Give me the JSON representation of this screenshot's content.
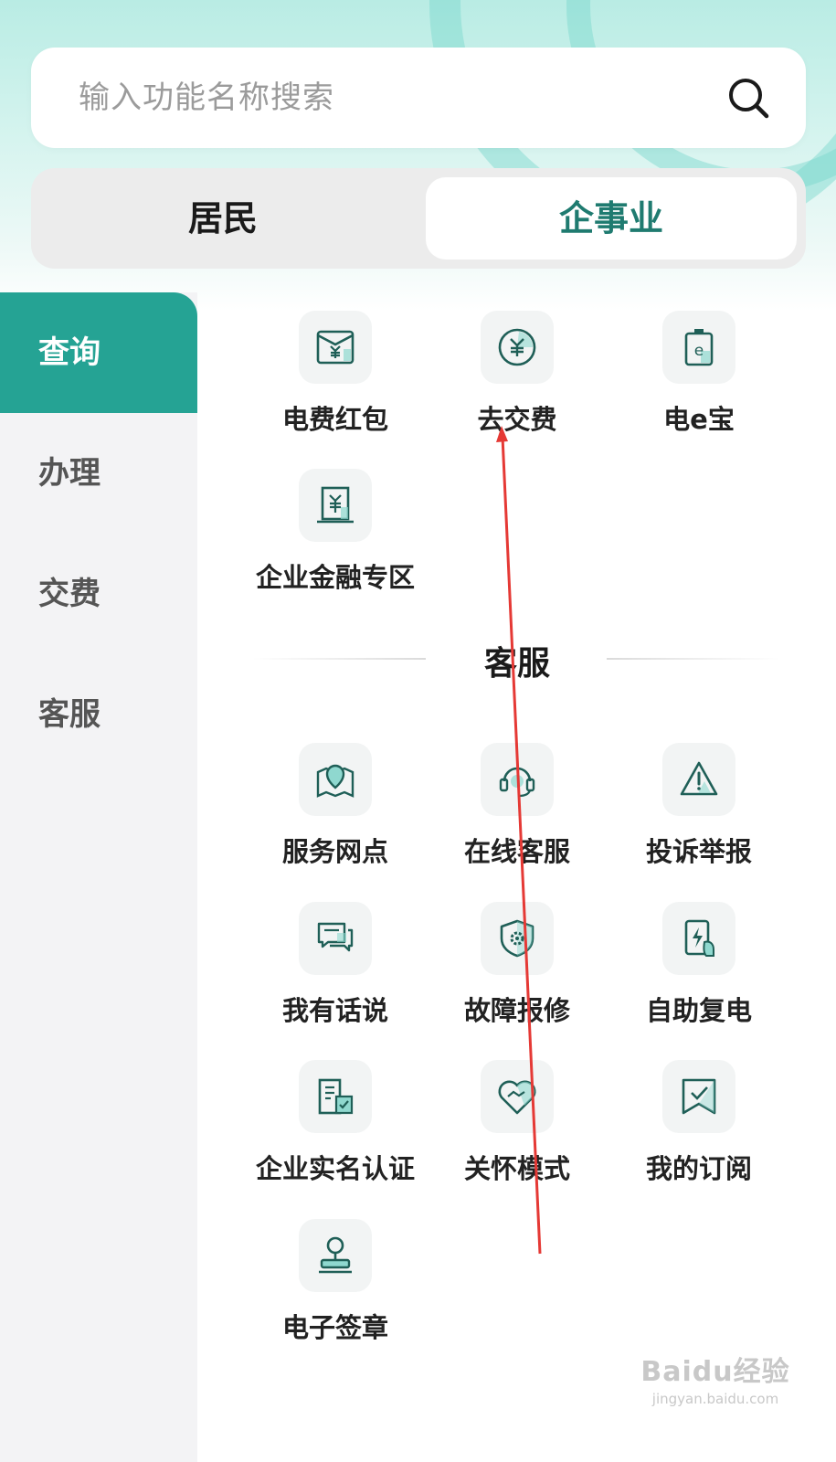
{
  "search": {
    "placeholder": "输入功能名称搜索",
    "icon": "search-icon"
  },
  "segment": {
    "tabs": [
      {
        "label": "居民",
        "active": false
      },
      {
        "label": "企事业",
        "active": true
      }
    ]
  },
  "sidebar": {
    "items": [
      {
        "label": "查询",
        "active": true
      },
      {
        "label": "办理",
        "active": false
      },
      {
        "label": "交费",
        "active": false
      },
      {
        "label": "客服",
        "active": false
      }
    ]
  },
  "query_items": [
    {
      "label": "电费红包",
      "icon": "bill-envelope-icon"
    },
    {
      "label": "去交费",
      "icon": "yuan-coin-icon"
    },
    {
      "label": "电e宝",
      "icon": "battery-e-icon"
    },
    {
      "label": "企业金融专区",
      "icon": "finance-building-icon"
    }
  ],
  "service_section": {
    "title": "客服"
  },
  "service_items": [
    {
      "label": "服务网点",
      "icon": "map-pin-icon"
    },
    {
      "label": "在线客服",
      "icon": "headset-icon"
    },
    {
      "label": "投诉举报",
      "icon": "warning-triangle-icon"
    },
    {
      "label": "我有话说",
      "icon": "chat-bubbles-icon"
    },
    {
      "label": "故障报修",
      "icon": "shield-gear-icon"
    },
    {
      "label": "自助复电",
      "icon": "phone-power-icon"
    },
    {
      "label": "企业实名认证",
      "icon": "building-check-icon"
    },
    {
      "label": "关怀模式",
      "icon": "heart-handshake-icon"
    },
    {
      "label": "我的订阅",
      "icon": "bookmark-check-icon"
    },
    {
      "label": "电子签章",
      "icon": "stamp-icon"
    }
  ],
  "colors": {
    "accent": "#25a394",
    "accent_dark": "#1f7b70",
    "annotation": "#e53935"
  },
  "watermark": {
    "logo": "Baidu经验",
    "url": "jingyan.baidu.com"
  }
}
